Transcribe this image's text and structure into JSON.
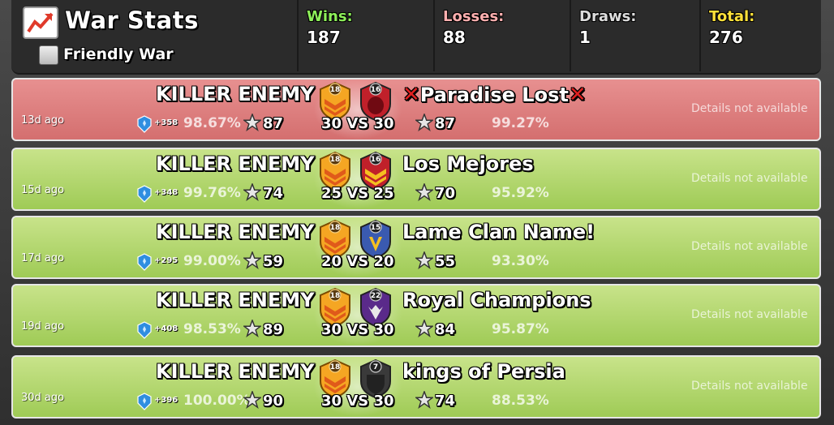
{
  "header": {
    "title": "War Stats",
    "friendly_war_label": "Friendly War",
    "friendly_war_checked": false,
    "stats": [
      {
        "label": "Wins:",
        "value": "187",
        "color": "#8ef05a"
      },
      {
        "label": "Losses:",
        "value": "88",
        "color": "#ffb0b0"
      },
      {
        "label": "Draws:",
        "value": "1",
        "color": "#dddddd"
      },
      {
        "label": "Total:",
        "value": "276",
        "color": "#ffe13a"
      }
    ]
  },
  "wars": [
    {
      "result": "loss",
      "ago": "13d ago",
      "clan": "KILLER ENEMY",
      "clan_level": "18",
      "opponent": "Paradise Lost",
      "opponent_level": "16",
      "opponent_marked": true,
      "trophies": "+358",
      "our_pct": "98.67%",
      "our_stars": "87",
      "size": "30 VS 30",
      "their_stars": "87",
      "their_pct": "99.27%",
      "details": "Details not available",
      "opp_badge": "red"
    },
    {
      "result": "win",
      "ago": "15d ago",
      "clan": "KILLER ENEMY",
      "clan_level": "18",
      "opponent": "Los Mejores",
      "opponent_level": "16",
      "opponent_marked": false,
      "trophies": "+348",
      "our_pct": "99.76%",
      "our_stars": "74",
      "size": "25 VS 25",
      "their_stars": "70",
      "their_pct": "95.92%",
      "details": "Details not available",
      "opp_badge": "chevron"
    },
    {
      "result": "win",
      "ago": "17d ago",
      "clan": "KILLER ENEMY",
      "clan_level": "18",
      "opponent": "Lame Clan Name!",
      "opponent_level": "15",
      "opponent_marked": false,
      "trophies": "+295",
      "our_pct": "99.00%",
      "our_stars": "59",
      "size": "20 VS 20",
      "their_stars": "55",
      "their_pct": "93.30%",
      "details": "Details not available",
      "opp_badge": "blue"
    },
    {
      "result": "win",
      "ago": "19d ago",
      "clan": "KILLER ENEMY",
      "clan_level": "18",
      "opponent": "Royal Champions",
      "opponent_level": "22",
      "opponent_marked": false,
      "trophies": "+408",
      "our_pct": "98.53%",
      "our_stars": "89",
      "size": "30 VS 30",
      "their_stars": "84",
      "their_pct": "95.87%",
      "details": "Details not available",
      "opp_badge": "purple"
    },
    {
      "result": "win",
      "ago": "30d ago",
      "clan": "KILLER ENEMY",
      "clan_level": "18",
      "opponent": "kings of Persia",
      "opponent_level": "7",
      "opponent_marked": false,
      "trophies": "+396",
      "our_pct": "100.00%",
      "our_stars": "90",
      "size": "30 VS 30",
      "their_stars": "74",
      "their_pct": "88.53%",
      "details": "Details not available",
      "opp_badge": "dark"
    }
  ]
}
